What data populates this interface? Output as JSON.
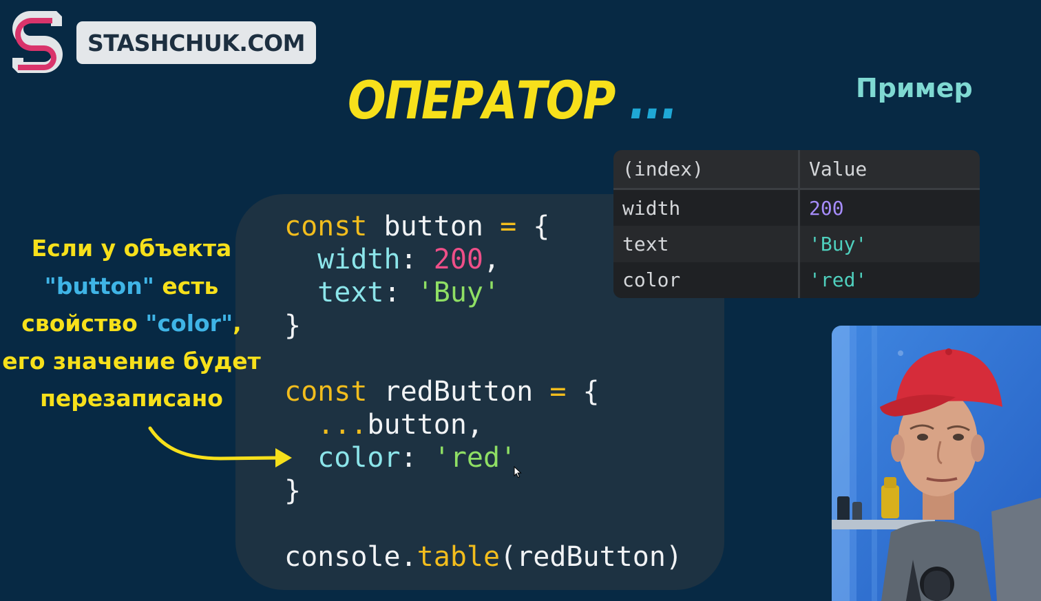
{
  "brand": {
    "name": "STASHCHUK.COM"
  },
  "slide": {
    "title": "ОПЕРАТОР",
    "title_dots": "...",
    "example_label": "Пример"
  },
  "note": {
    "line1": "Если у объекта",
    "line2_q1": "\"button\"",
    "line2_rest": " есть",
    "line3_pre": "свойство ",
    "line3_q": "\"color\"",
    "line3_post": ",",
    "line4": "его значение будет",
    "line5": "перезаписано"
  },
  "code": {
    "kw_const": "const",
    "var_button": "button",
    "var_redbutton": "redButton",
    "op_assign": "=",
    "brace_open": "{",
    "brace_close": "}",
    "prop_width": "width",
    "val_width": "200",
    "prop_text": "text",
    "val_text": "'Buy'",
    "spread": "...",
    "prop_color": "color",
    "val_color": "'red'",
    "console_obj": "console",
    "console_method": "table",
    "console_arg": "redButton"
  },
  "console_table": {
    "headers": [
      "(index)",
      "Value"
    ],
    "rows": [
      {
        "index": "width",
        "value": "200"
      },
      {
        "index": "text",
        "value": "'Buy'"
      },
      {
        "index": "color",
        "value": "'red'"
      }
    ]
  },
  "colors": {
    "background": "#072944",
    "title_yellow": "#f7e01b",
    "accent_blue": "#1fa8d6",
    "keyword": "#f2bd1d",
    "number": "#ef4f88",
    "string": "#8fdf64",
    "property": "#8ce5ea"
  }
}
